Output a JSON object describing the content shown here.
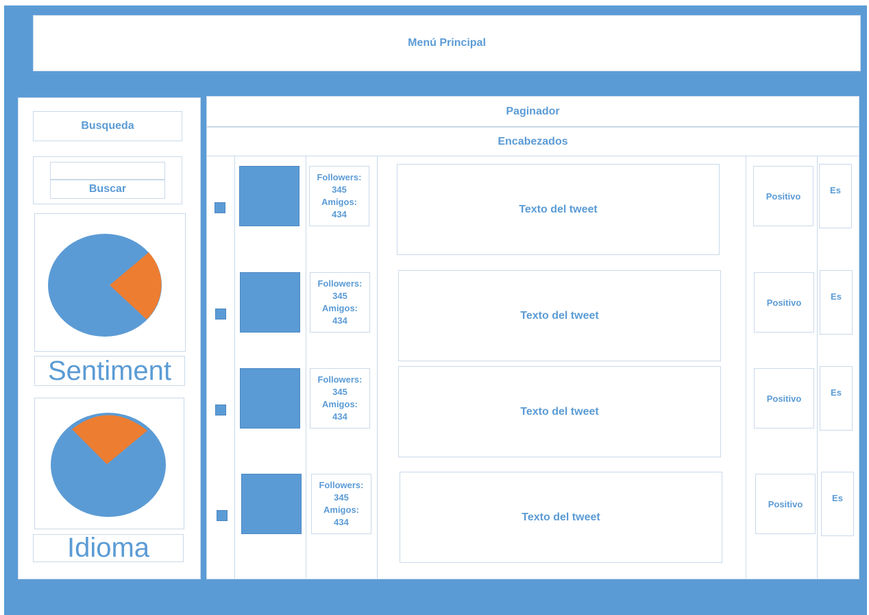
{
  "menu": {
    "title": "Menú Principal"
  },
  "sidebar": {
    "search_heading": "Busqueda",
    "search_input_value": "",
    "search_button": "Buscar",
    "chart1_label": "Sentiment",
    "chart2_label": "Idioma"
  },
  "main": {
    "paginator": "Paginador",
    "headers": "Encabezados",
    "rows": [
      {
        "followers_label": "Followers:",
        "followers": "345",
        "friends_label": "Amigos:",
        "friends": "434",
        "tweet": "Texto del tweet",
        "sentiment": "Positivo",
        "lang": "Es"
      },
      {
        "followers_label": "Followers:",
        "followers": "345",
        "friends_label": "Amigos:",
        "friends": "434",
        "tweet": "Texto del tweet",
        "sentiment": "Positivo",
        "lang": "Es"
      },
      {
        "followers_label": "Followers:",
        "followers": "345",
        "friends_label": "Amigos:",
        "friends": "434",
        "tweet": "Texto del tweet",
        "sentiment": "Positivo",
        "lang": "Es"
      },
      {
        "followers_label": "Followers:",
        "followers": "345",
        "friends_label": "Amigos:",
        "friends": "434",
        "tweet": "Texto del tweet",
        "sentiment": "Positivo",
        "lang": "Es"
      }
    ]
  },
  "colors": {
    "frame": "#5b9bd5",
    "accent": "#ed7d31",
    "text": "#5b9bd5"
  },
  "chart_data": [
    {
      "type": "pie",
      "slices": [
        {
          "share": 0.8
        },
        {
          "share": 0.2
        }
      ]
    },
    {
      "type": "pie",
      "slices": [
        {
          "share": 0.8
        },
        {
          "share": 0.2
        }
      ]
    }
  ]
}
